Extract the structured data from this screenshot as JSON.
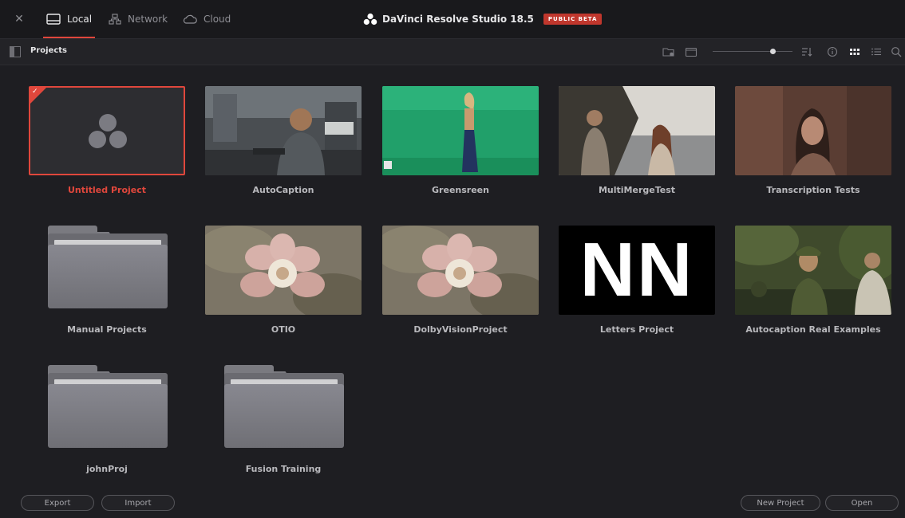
{
  "header": {
    "tabs": [
      {
        "label": "Local",
        "icon": "drive-icon",
        "active": true
      },
      {
        "label": "Network",
        "icon": "network-icon",
        "active": false
      },
      {
        "label": "Cloud",
        "icon": "cloud-icon",
        "active": false
      }
    ],
    "app_title": "DaVinci Resolve Studio 18.5",
    "beta_badge": "PUBLIC BETA",
    "accent_color": "#e0473c"
  },
  "subbar": {
    "breadcrumb": "Projects",
    "zoom_slider_level": 0.75
  },
  "projects": [
    {
      "name": "Untitled Project",
      "kind": "project",
      "selected": true,
      "thumbnail": "resolve-logo"
    },
    {
      "name": "AutoCaption",
      "kind": "project",
      "thumbnail": "man-in-workshop"
    },
    {
      "name": "Greensreen",
      "kind": "project",
      "thumbnail": "woman-on-greenscreen"
    },
    {
      "name": "MultiMergeTest",
      "kind": "project",
      "thumbnail": "two-people-on-beach"
    },
    {
      "name": "Transcription Tests",
      "kind": "project",
      "thumbnail": "woman-in-dim-light"
    },
    {
      "name": "Manual Projects",
      "kind": "folder"
    },
    {
      "name": "OTIO",
      "kind": "project",
      "thumbnail": "pink-flower"
    },
    {
      "name": "DolbyVisionProject",
      "kind": "project",
      "thumbnail": "pink-flower"
    },
    {
      "name": "Letters Project",
      "kind": "project",
      "thumbnail": "letters",
      "thumb_text": "NN"
    },
    {
      "name": "Autocaption Real Examples",
      "kind": "project",
      "thumbnail": "soldier-in-jungle"
    },
    {
      "name": "johnProj",
      "kind": "folder"
    },
    {
      "name": "Fusion Training",
      "kind": "folder"
    }
  ],
  "footer": {
    "export_label": "Export",
    "import_label": "Import",
    "new_project_label": "New Project",
    "open_label": "Open"
  }
}
